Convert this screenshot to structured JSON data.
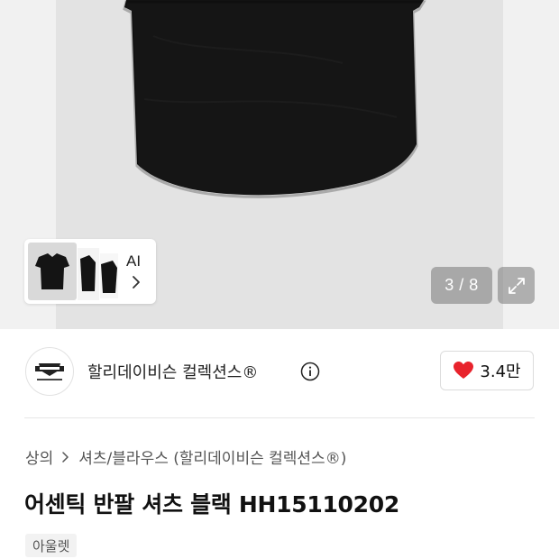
{
  "gallery": {
    "thumbnail_label": "AI",
    "counter": "3 / 8"
  },
  "brand": {
    "name": "할리데이비슨 컬렉션스®",
    "likes": "3.4만"
  },
  "breadcrumb": {
    "items": [
      "상의",
      "셔츠/블라우스 (할리데이비슨 컬렉션스®)"
    ]
  },
  "product": {
    "title": "어센틱 반팔 셔츠 블랙 HH15110202",
    "badge": "아울렛"
  },
  "colors": {
    "heart": "#e8232c",
    "shirt": "#151515",
    "gallery_bg": "#e3e3e3"
  },
  "icons": [
    "chevron-right-icon",
    "expand-icon",
    "info-icon",
    "heart-icon",
    "brand-logo"
  ]
}
